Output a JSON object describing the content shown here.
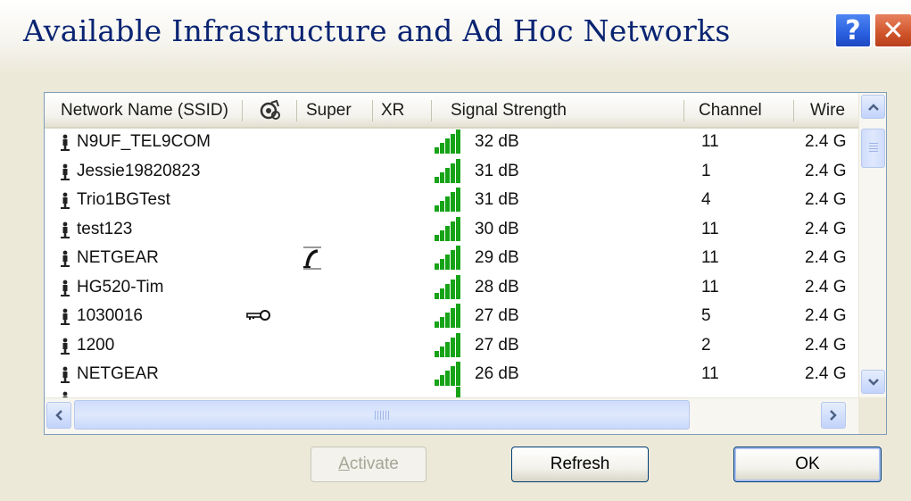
{
  "window": {
    "title": "Available Infrastructure and Ad Hoc Networks",
    "help_label": "?",
    "close_label": "✕"
  },
  "columns": {
    "ssid": "Network Name (SSID)",
    "super": "Super",
    "xr": "XR",
    "signal": "Signal Strength",
    "channel": "Channel",
    "wireless": "Wire"
  },
  "networks": [
    {
      "ssid": "N9UF_TEL9COM",
      "signal": "32 dB",
      "channel": "11",
      "band": "2.4 G",
      "icon": "none"
    },
    {
      "ssid": "Jessie19820823",
      "signal": "31 dB",
      "channel": "1",
      "band": "2.4 G",
      "icon": "none"
    },
    {
      "ssid": "Trio1BGTest",
      "signal": "31 dB",
      "channel": "4",
      "band": "2.4 G",
      "icon": "none"
    },
    {
      "ssid": "test123",
      "signal": "30 dB",
      "channel": "11",
      "band": "2.4 G",
      "icon": "none"
    },
    {
      "ssid": "NETGEAR",
      "signal": "29 dB",
      "channel": "11",
      "band": "2.4 G",
      "icon": "super-icon"
    },
    {
      "ssid": "HG520-Tim",
      "signal": "28 dB",
      "channel": "11",
      "band": "2.4 G",
      "icon": "none"
    },
    {
      "ssid": "1030016",
      "signal": "27 dB",
      "channel": "5",
      "band": "2.4 G",
      "icon": "key-icon"
    },
    {
      "ssid": "1200",
      "signal": "27 dB",
      "channel": "2",
      "band": "2.4 G",
      "icon": "none"
    },
    {
      "ssid": "NETGEAR",
      "signal": "26 dB",
      "channel": "11",
      "band": "2.4 G",
      "icon": "none"
    }
  ],
  "scroll_grip": "III",
  "buttons": {
    "activate_prefix": "",
    "activate_mnemonic": "A",
    "activate_rest": "ctivate",
    "refresh": "Refresh",
    "ok": "OK"
  },
  "colors": {
    "title_text": "#0a2472",
    "signal_green": "#17a317",
    "help_blue": "#2a5fe0",
    "close_red": "#d0542a"
  }
}
